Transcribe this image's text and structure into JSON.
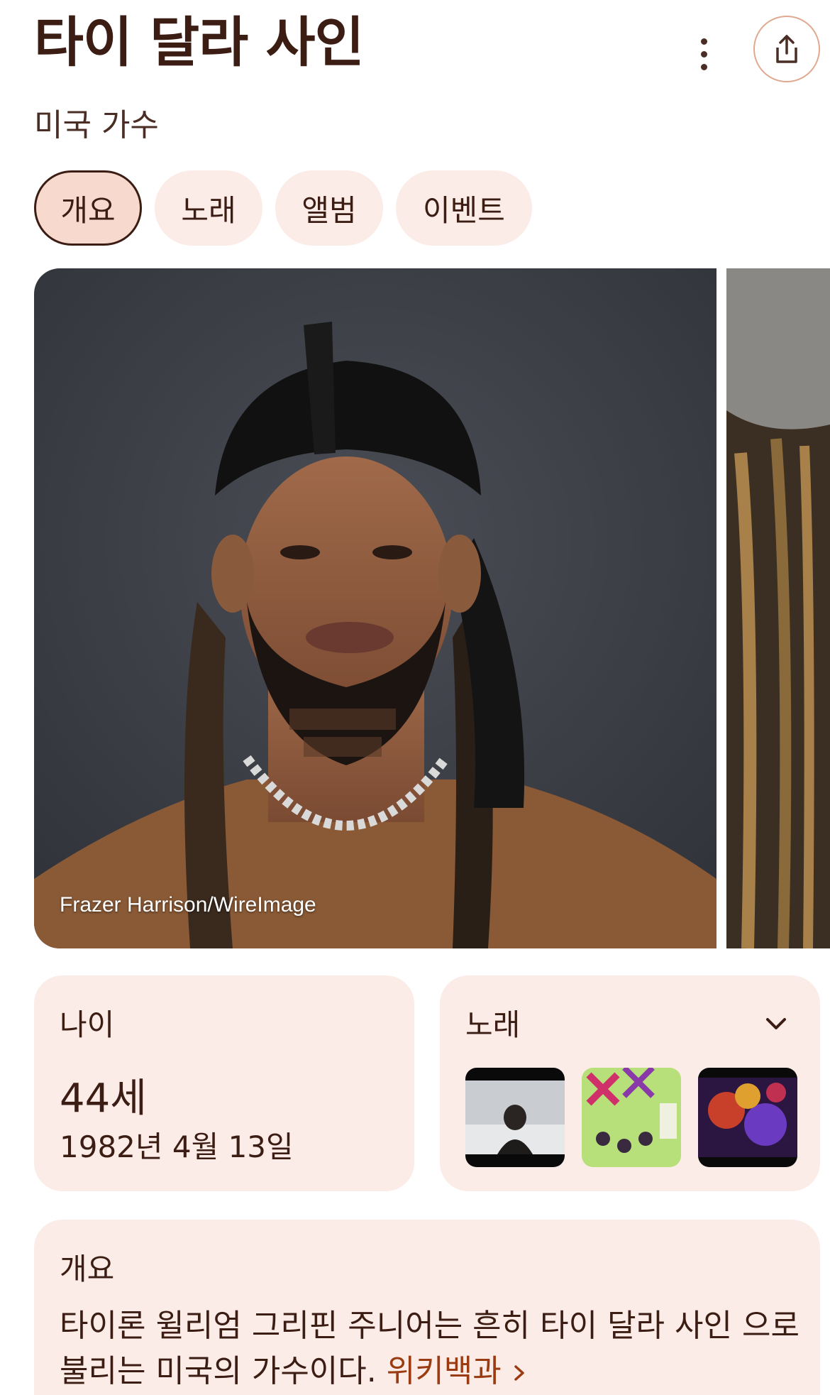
{
  "header": {
    "title": "타이 달라 사인",
    "subtitle": "미국 가수",
    "more_icon": "more-vert-icon",
    "share_icon": "share-icon"
  },
  "tabs": [
    {
      "label": "개요",
      "active": true
    },
    {
      "label": "노래",
      "active": false
    },
    {
      "label": "앨범",
      "active": false
    },
    {
      "label": "이벤트",
      "active": false
    }
  ],
  "photo": {
    "credit": "Frazer Harrison/WireImage"
  },
  "age_card": {
    "label": "나이",
    "value": "44세",
    "birthdate": "1982년 4월 13일"
  },
  "songs_card": {
    "label": "노래",
    "expand_icon": "chevron-down-icon"
  },
  "overview": {
    "label": "개요",
    "text": "타이론 윌리엄 그리핀 주니어는 흔히 타이 달라 사인 으로 불리는 미국의 가수이다.",
    "link": "위키백과",
    "link_icon": "chevron-right-icon"
  },
  "colors": {
    "accent": "#3b1d14",
    "chip_bg": "#fbece7",
    "chip_active_bg": "#f7d9ce",
    "link": "#9a3b12",
    "share_border": "#e0a88e"
  }
}
